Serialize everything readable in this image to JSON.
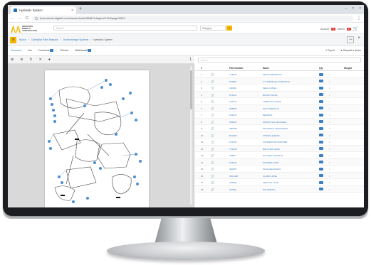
{
  "browser": {
    "tab_title": "Hydraulic System",
    "tab_close": "×",
    "new_tab": "+",
    "window_controls": [
      "–",
      "□",
      "×"
    ],
    "nav": {
      "back": "←",
      "forward": "→",
      "reload": "C"
    },
    "url": "documents.digidel.com/viewer/book/38487/chapter/2118/page/2541"
  },
  "header": {
    "logo_lines": [
      "INDUSTRIAL",
      "MINING &",
      "CONSTRUCTION"
    ],
    "search_placeholder": "Search",
    "category": "Category",
    "account_label": "Account",
    "account_badge": "1",
    "orders_label": "Orders",
    "orders_badge": "1"
  },
  "breadcrumb": {
    "items": [
      "Books",
      "Caterpillar Parts Manuals",
      "Undercarriage Systems",
      "Hydraulic System"
    ]
  },
  "tabs": {
    "items": [
      "Document",
      "Info",
      "Comments",
      "Pictures",
      "Whiteboard"
    ],
    "active": "Document",
    "right_actions": [
      "Export",
      "Request a Quote"
    ]
  },
  "viewer": {
    "page_indicator": "1"
  },
  "parts_table": {
    "filter_placeholder": "Search",
    "columns": [
      "#",
      "",
      "Part Number",
      "Name",
      "Qty",
      "Weight"
    ],
    "rows": [
      {
        "num": "1",
        "part": "7Y5432",
        "name": "SEALS REPAIR KIT",
        "qty": "1"
      },
      {
        "num": "2",
        "part": "6T2815",
        "name": "CYLINDER AS-HYDRAULIC",
        "qty": "1"
      },
      {
        "num": "3",
        "part": "4J0520",
        "name": "SEAL-O-RING",
        "qty": "2"
      },
      {
        "num": "4",
        "part": "8T4121",
        "name": "BLOCK-VALVE",
        "qty": "1"
      },
      {
        "num": "5",
        "part": "1R0716",
        "name": "TUBE AS-FLANGE",
        "qty": "1"
      },
      {
        "num": "6",
        "part": "9X8256",
        "name": "KIT-HYDRAULIC",
        "qty": "1"
      },
      {
        "num": "7",
        "part": "3S3478",
        "name": "BEARING",
        "qty": "2"
      },
      {
        "num": "8",
        "part": "5P6622",
        "name": "SPRING-VALVE RELIEF",
        "qty": "1"
      },
      {
        "num": "9",
        "part": "2M9780",
        "name": "PIN-SPOOL ANCHORING",
        "qty": "4"
      },
      {
        "num": "10",
        "part": "8C3206",
        "name": "FITTING-ELBOW",
        "qty": "1"
      },
      {
        "num": "11",
        "part": "1P3703",
        "name": "CONNECTOR-ADAPTER",
        "qty": "2"
      },
      {
        "num": "12",
        "part": "7X2548",
        "name": "BOLT-HEX HEAD",
        "qty": "1"
      },
      {
        "num": "13",
        "part": "3T8071",
        "name": "NUT-HEX LOCKNUT",
        "qty": "1"
      },
      {
        "num": "14",
        "part": "6V5192",
        "name": "WASHER-HARD",
        "qty": "3"
      },
      {
        "num": "15",
        "part": "4K0367",
        "name": "PLUG-HEADLESS",
        "qty": "1"
      },
      {
        "num": "16",
        "part": "095-1987",
        "name": "CLAMP-HOSE",
        "qty": "1"
      },
      {
        "num": "17",
        "part": "2S5658",
        "name": "SEAL-LIP TYPE",
        "qty": "2"
      },
      {
        "num": "18",
        "part": "5J2506",
        "name": "PIN-SPRING",
        "qty": "1"
      }
    ]
  },
  "colors": {
    "accent": "#f5b400",
    "link": "#3b7fc4",
    "alert": "#e53935",
    "bezel": "#1b1d20"
  },
  "icons": {
    "cart": "cart-icon",
    "menu": "hamburger-icon",
    "search": "search-icon"
  }
}
